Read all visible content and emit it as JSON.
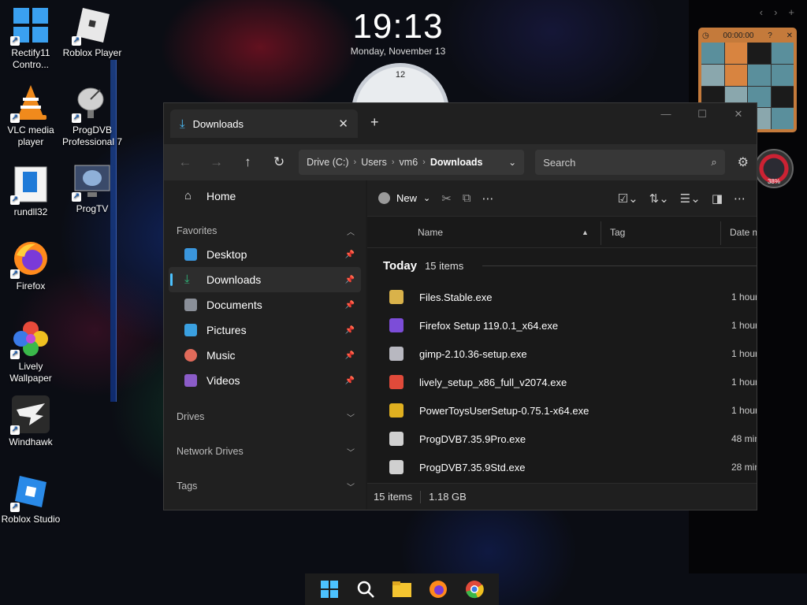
{
  "desktop": {
    "icons": [
      {
        "label": "Rectify11 Contro...",
        "icon": "rectify11-icon"
      },
      {
        "label": "Roblox Player",
        "icon": "roblox-player-icon"
      },
      {
        "label": "VLC media player",
        "icon": "vlc-icon"
      },
      {
        "label": "ProgDVB Professional 7",
        "icon": "progdvb-icon"
      },
      {
        "label": "rundll32",
        "icon": "rundll32-icon"
      },
      {
        "label": "ProgTV",
        "icon": "progtv-icon"
      },
      {
        "label": "Firefox",
        "icon": "firefox-icon"
      },
      {
        "label": "Lively Wallpaper",
        "icon": "lively-wallpaper-icon"
      },
      {
        "label": "Windhawk",
        "icon": "windhawk-icon"
      },
      {
        "label": "Roblox Studio",
        "icon": "roblox-studio-icon"
      }
    ]
  },
  "clock": {
    "time": "19:13",
    "date": "Monday, November 13",
    "dial_number": "12"
  },
  "puzzle": {
    "timer": "00:00:00",
    "help": "?"
  },
  "gauge": {
    "percent_label": "38%"
  },
  "explorer": {
    "tab_title": "Downloads",
    "breadcrumb": [
      "Drive (C:)",
      "Users",
      "vm6",
      "Downloads"
    ],
    "search_placeholder": "Search",
    "sidebar": {
      "home": "Home",
      "favorites_header": "Favorites",
      "favorites": [
        {
          "label": "Desktop",
          "color": "#3a96dd"
        },
        {
          "label": "Downloads",
          "color": "#2fb87a",
          "active": true
        },
        {
          "label": "Documents",
          "color": "#8a8f98"
        },
        {
          "label": "Pictures",
          "color": "#3aa0e0"
        },
        {
          "label": "Music",
          "color": "#e06a5a"
        },
        {
          "label": "Videos",
          "color": "#8b5cc8"
        }
      ],
      "drives_header": "Drives",
      "network_header": "Network Drives",
      "tags_header": "Tags"
    },
    "command_bar": {
      "new_label": "New"
    },
    "columns": {
      "name": "Name",
      "tag": "Tag",
      "date": "Date m"
    },
    "group": {
      "title": "Today",
      "count": "15 items"
    },
    "files": [
      {
        "name": "Files.Stable.exe",
        "date": "1 hour",
        "color": "#d9b24a"
      },
      {
        "name": "Firefox Setup 119.0.1_x64.exe",
        "date": "1 hour",
        "color": "#7c4dd8"
      },
      {
        "name": "gimp-2.10.36-setup.exe",
        "date": "1 hour",
        "color": "#b8b8c0"
      },
      {
        "name": "lively_setup_x86_full_v2074.exe",
        "date": "1 hour",
        "color": "#e04a3a"
      },
      {
        "name": "PowerToysUserSetup-0.75.1-x64.exe",
        "date": "1 hour",
        "color": "#e0b020"
      },
      {
        "name": "ProgDVB7.35.9Pro.exe",
        "date": "48 min",
        "color": "#d0d0d0"
      },
      {
        "name": "ProgDVB7.35.9Std.exe",
        "date": "28 min",
        "color": "#d0d0d0"
      }
    ],
    "status": {
      "count": "15 items",
      "size": "1.18 GB"
    }
  }
}
